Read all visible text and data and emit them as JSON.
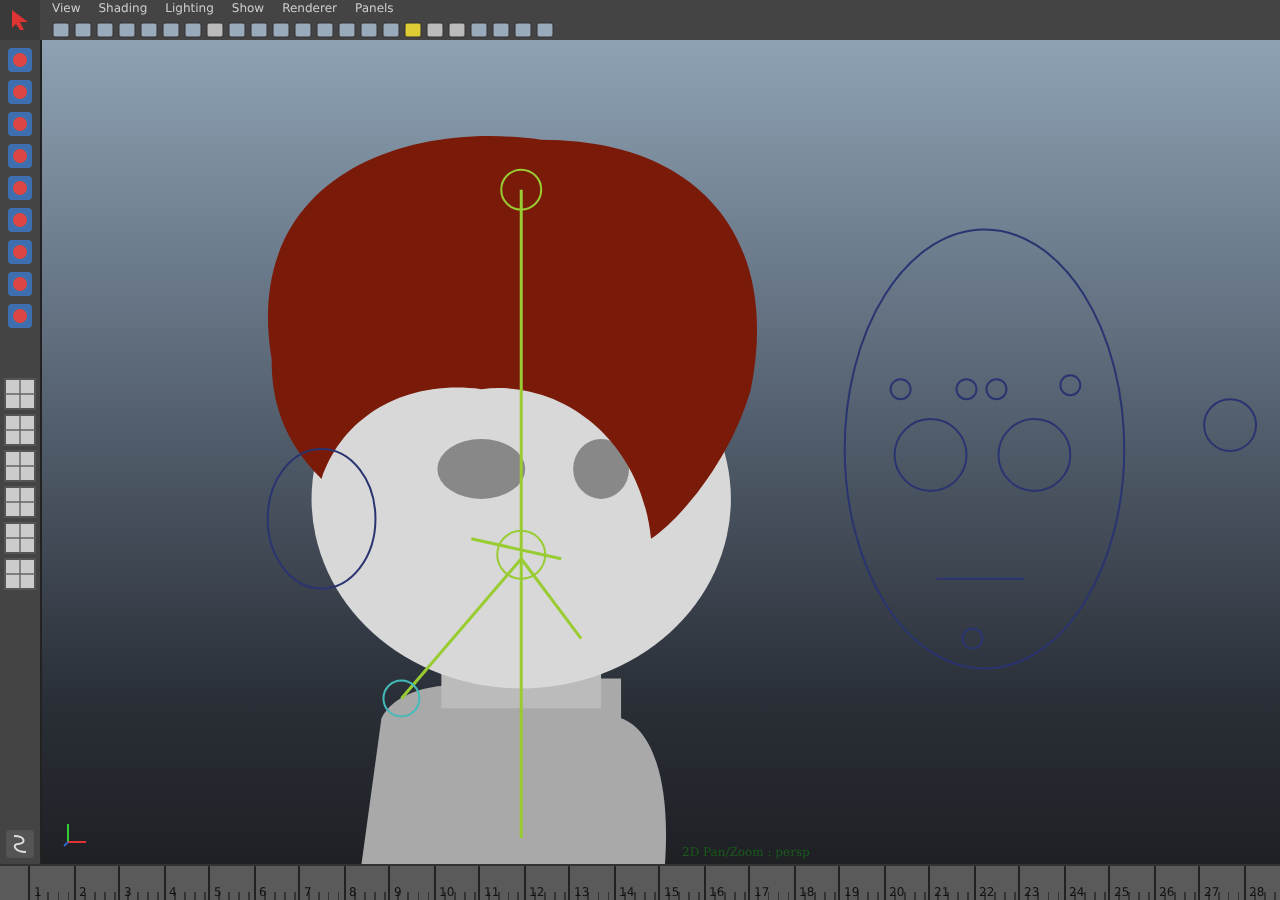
{
  "menu": [
    "View",
    "Shading",
    "Lighting",
    "Show",
    "Renderer",
    "Panels"
  ],
  "viewport": {
    "label": "2D Pan/Zoom : persp"
  },
  "timeline": {
    "ticks": [
      "1",
      "2",
      "3",
      "4",
      "5",
      "6",
      "7",
      "8",
      "9",
      "10",
      "11",
      "12",
      "13",
      "14",
      "15",
      "16",
      "17",
      "18",
      "19",
      "20",
      "21",
      "22",
      "23",
      "24",
      "25",
      "26",
      "27",
      "28"
    ]
  }
}
